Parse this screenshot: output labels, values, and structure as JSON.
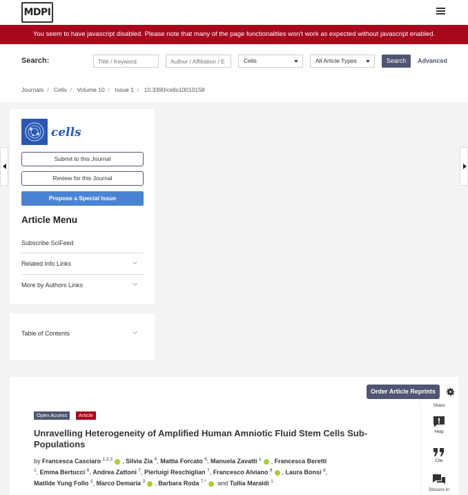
{
  "brand": {
    "logo_text": "MDPI"
  },
  "js_warning": "You seem to have javascript disabled. Please note that many of the page functionalities won't work as expected without javascript enabled.",
  "search": {
    "label": "Search:",
    "title_placeholder": "Title / Keyword",
    "author_placeholder": "Author / Affiliation / E",
    "journal_select": "Cells",
    "type_select": "All Article Types",
    "button": "Search",
    "advanced": "Advanced"
  },
  "breadcrumb": [
    "Journals",
    "Cells",
    "Volume 10",
    "Issue 1",
    "10.3390/cells10010158"
  ],
  "sidebar": {
    "journal_name": "cells",
    "submit": "Submit to this Journal",
    "review": "Review for this Journal",
    "propose": "Propose a Special Issue",
    "menu_title": "Article Menu",
    "items": [
      "Subscribe SciFeed",
      "Related Info Links",
      "More by Authors Links"
    ],
    "toc": "Table of Contents"
  },
  "article": {
    "reprints": "Order Article Reprints",
    "tags": [
      "Open Access",
      "Article"
    ],
    "title": "Unravelling Heterogeneity of Amplified Human Amniotic Fluid Stem Cells Sub-Populations",
    "by": "by",
    "authors": [
      {
        "name": "Francesca Casciaro",
        "sup": "1,2,3",
        "orcid": true
      },
      {
        "name": "Silvia Zia",
        "sup": "4",
        "orcid": false
      },
      {
        "name": "Mattia Forcato",
        "sup": "5",
        "orcid": false
      },
      {
        "name": "Manuela Zavatti",
        "sup": "1",
        "orcid": true
      },
      {
        "name": "Francesca Beretti",
        "sup": "1",
        "orcid": false
      },
      {
        "name": "Emma Bertucci",
        "sup": "6",
        "orcid": false
      },
      {
        "name": "Andrea Zattoni",
        "sup": "7",
        "orcid": false
      },
      {
        "name": "Pierluigi Reschiglian",
        "sup": "7",
        "orcid": false
      },
      {
        "name": "Francesco Alviano",
        "sup": "8",
        "orcid": true
      },
      {
        "name": "Laura Bonsi",
        "sup": "8",
        "orcid": false
      },
      {
        "name": "Matilde Yung Follo",
        "sup": "2",
        "orcid": false
      },
      {
        "name": "Marco Demaria",
        "sup": "3",
        "orcid": true
      },
      {
        "name": "Barbara Roda",
        "sup": "7,*",
        "orcid": true
      },
      {
        "name": "Tullia Maraldi",
        "sup": "1",
        "orcid": false
      }
    ],
    "and": "and",
    "side_tools": [
      "Share",
      "Help",
      "Cite",
      "Discuss in"
    ]
  },
  "colors": {
    "alert": "#a8061c",
    "primary": "#4f5671",
    "accent_blue": "#4a83d4",
    "orcid": "#a6ce39"
  }
}
